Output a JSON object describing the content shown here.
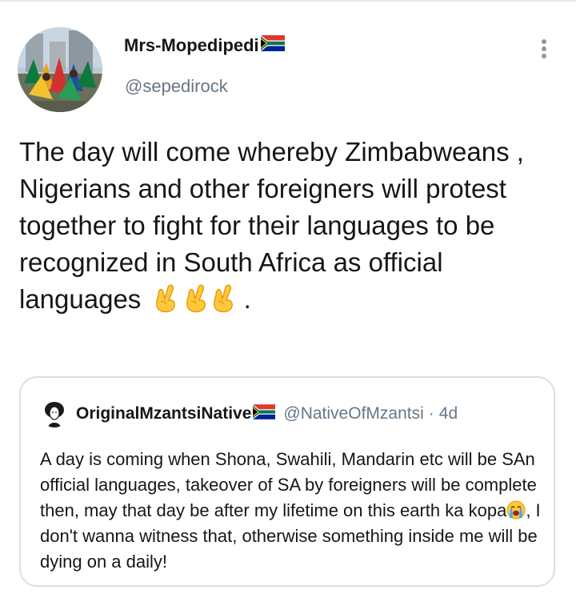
{
  "tweet": {
    "display_name": "Mrs-Mopedipedi",
    "handle": "@sepedirock",
    "text_main": "The day will come whereby Zimbabweans , Nigerians and other foreigners will protest together to fight for their languages to be recognized in South Africa as official languages",
    "text_end": ".",
    "emojis": [
      "crossed-fingers",
      "crossed-fingers",
      "crossed-fingers"
    ],
    "more_icon": "more-vertical-icon"
  },
  "quote": {
    "display_name": "OriginalMzantsiNative",
    "handle": "@NativeOfMzantsi",
    "separator": "·",
    "time": "4d",
    "text_part1": "A day is coming when Shona, Swahili, Mandarin etc will be SAn official languages, takeover of SA by foreigners will be complete then, may that day be after my lifetime on this earth ka kopa",
    "text_part2": ", I don't wanna witness that, otherwise something inside me will be dying on a daily!"
  },
  "colors": {
    "text": "#14171a",
    "secondary": "#657786",
    "border": "#d8dfe4",
    "icon": "#8899a6"
  }
}
